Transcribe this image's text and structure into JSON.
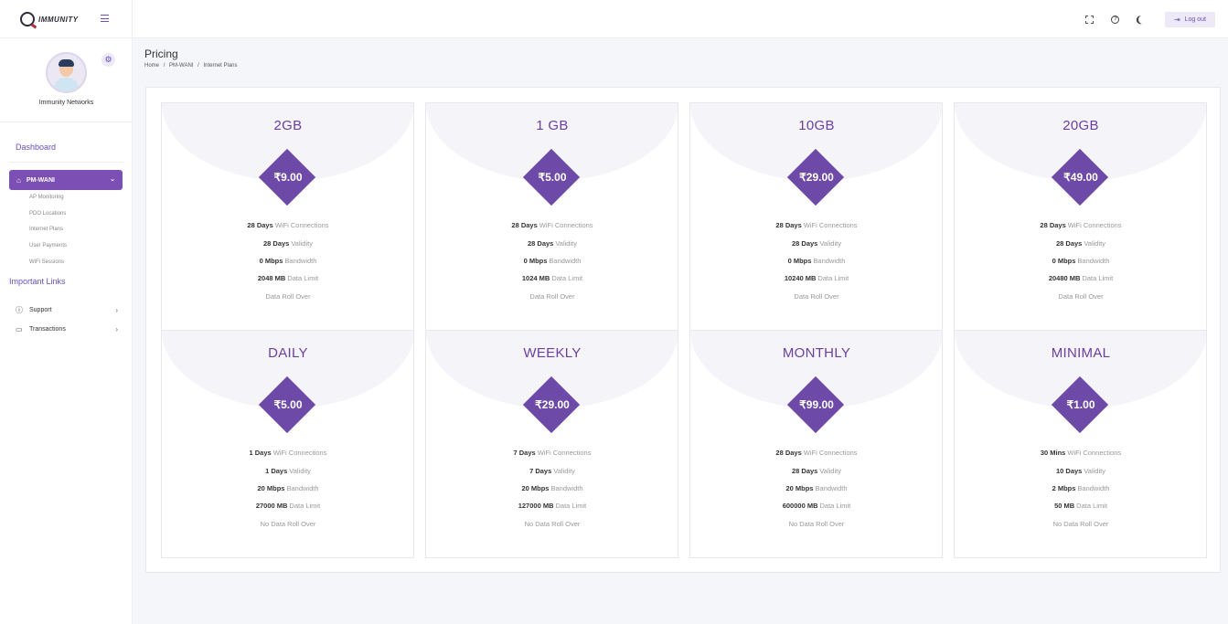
{
  "header": {
    "logo_text": "IMMUNITY",
    "logout_label": "Log out"
  },
  "sidebar": {
    "profile_name": "Immunity Networks",
    "dashboard_label": "Dashboard",
    "active_section": "PM-WANI",
    "sub_items": [
      "AP Monitoring",
      "PDO Locations",
      "Internet Plans",
      "User Payments",
      "WiFi Sessions"
    ],
    "important_links_label": "Important Links",
    "support_label": "Support",
    "transactions_label": "Transactions"
  },
  "page": {
    "title": "Pricing",
    "breadcrumb": [
      "Home",
      "/",
      "PM-WANI",
      "/",
      "Internet Plans"
    ]
  },
  "feature_labels": {
    "connections": "WiFi Connections",
    "validity": "Validity",
    "bandwidth": "Bandwidth",
    "data_limit": "Data Limit"
  },
  "plans": [
    {
      "name": "2GB",
      "price": "₹9.00",
      "connections": "28 Days",
      "validity": "28 Days",
      "bandwidth": "0 Mbps",
      "data_limit": "2048 MB",
      "rollover": "Data Roll Over"
    },
    {
      "name": "1 GB",
      "price": "₹5.00",
      "connections": "28 Days",
      "validity": "28 Days",
      "bandwidth": "0 Mbps",
      "data_limit": "1024 MB",
      "rollover": "Data Roll Over"
    },
    {
      "name": "10GB",
      "price": "₹29.00",
      "connections": "28 Days",
      "validity": "28 Days",
      "bandwidth": "0 Mbps",
      "data_limit": "10240 MB",
      "rollover": "Data Roll Over"
    },
    {
      "name": "20GB",
      "price": "₹49.00",
      "connections": "28 Days",
      "validity": "28 Days",
      "bandwidth": "0 Mbps",
      "data_limit": "20480 MB",
      "rollover": "Data Roll Over"
    },
    {
      "name": "DAILY",
      "price": "₹5.00",
      "connections": "1 Days",
      "validity": "1 Days",
      "bandwidth": "20 Mbps",
      "data_limit": "27000 MB",
      "rollover": "No Data Roll Over"
    },
    {
      "name": "WEEKLY",
      "price": "₹29.00",
      "connections": "7 Days",
      "validity": "7 Days",
      "bandwidth": "20 Mbps",
      "data_limit": "127000 MB",
      "rollover": "No Data Roll Over"
    },
    {
      "name": "MONTHLY",
      "price": "₹99.00",
      "connections": "28 Days",
      "validity": "28 Days",
      "bandwidth": "20 Mbps",
      "data_limit": "600000 MB",
      "rollover": "No Data Roll Over"
    },
    {
      "name": "MINIMAL",
      "price": "₹1.00",
      "connections": "30 Mins",
      "validity": "10 Days",
      "bandwidth": "2 Mbps",
      "data_limit": "50 MB",
      "rollover": "No Data Roll Over"
    }
  ],
  "colors": {
    "accent": "#6e4aa8",
    "nav_active": "#7b4fb3"
  }
}
